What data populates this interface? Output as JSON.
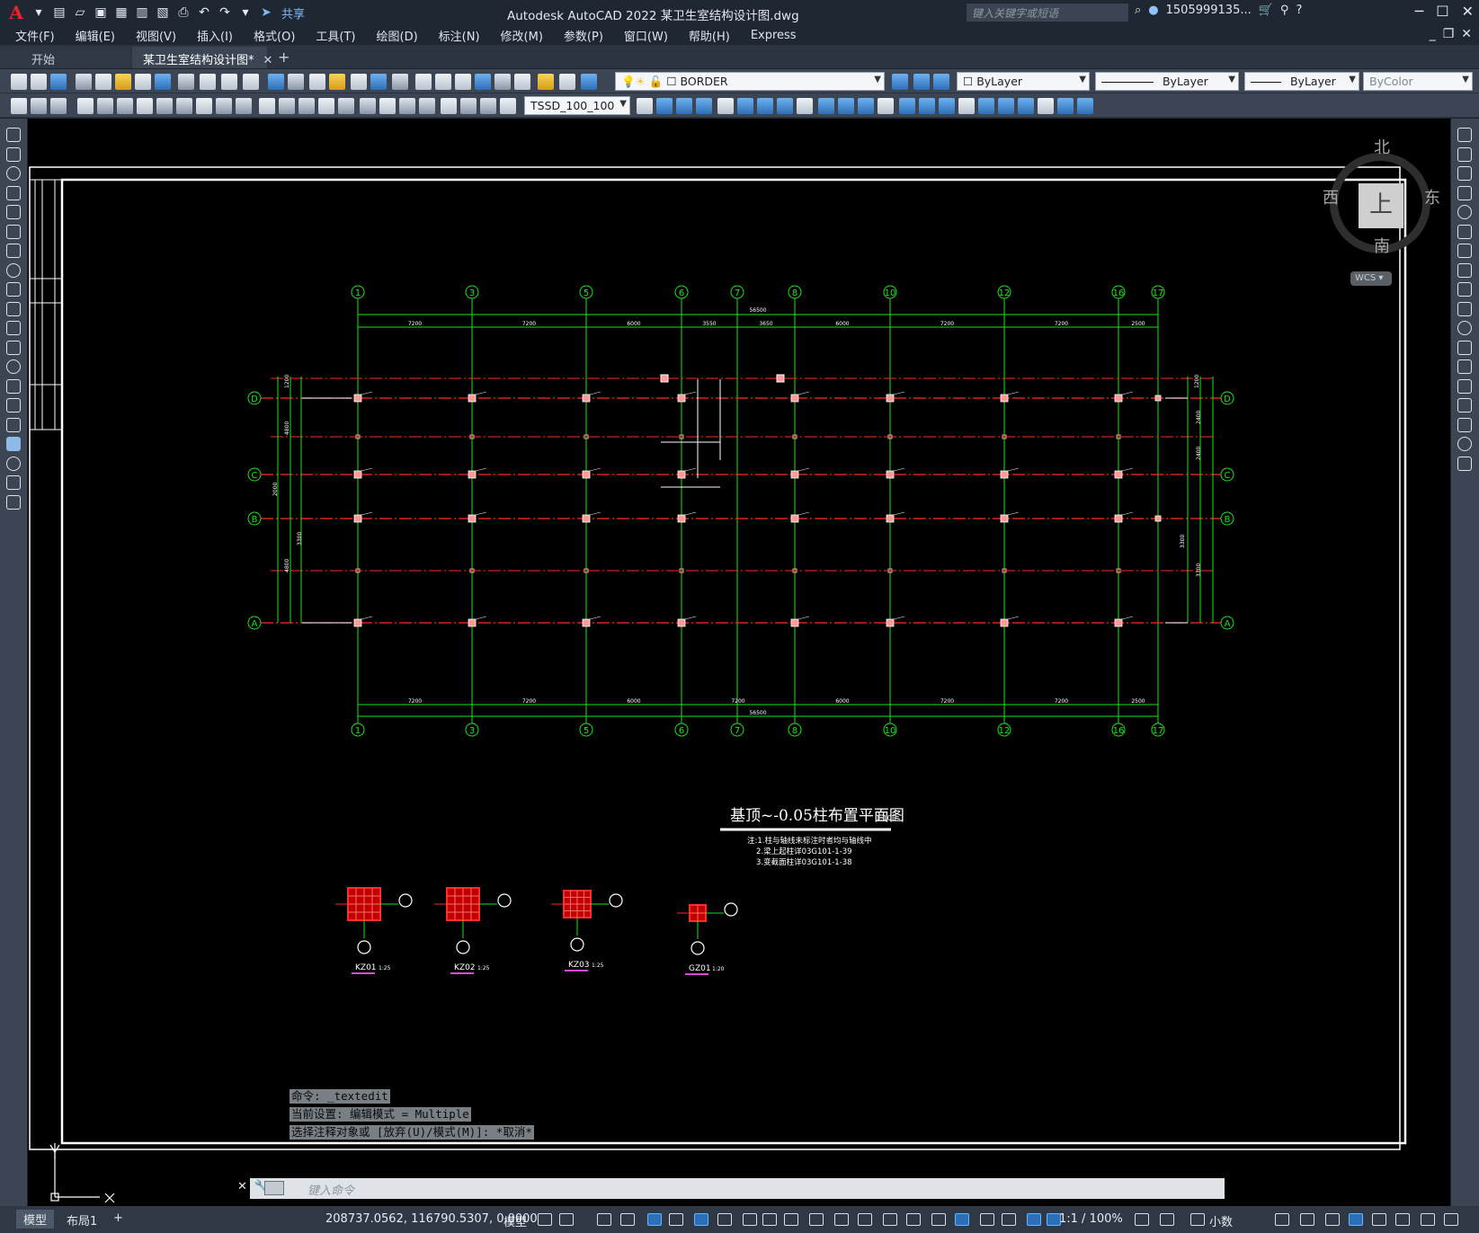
{
  "titlebar": {
    "share_label": "共享",
    "app_title": "Autodesk AutoCAD 2022    某卫生室结构设计图.dwg",
    "search_placeholder": "键入关键字或短语",
    "user": "1505999135...",
    "logo_letter": "A"
  },
  "menu": {
    "items": [
      "文件(F)",
      "编辑(E)",
      "视图(V)",
      "插入(I)",
      "格式(O)",
      "工具(T)",
      "绘图(D)",
      "标注(N)",
      "修改(M)",
      "参数(P)",
      "窗口(W)",
      "帮助(H)",
      "Express"
    ]
  },
  "tabs": {
    "start": "开始",
    "drawing": "某卫生室结构设计图*",
    "add": "+"
  },
  "toolbar": {
    "layer": "BORDER",
    "color": "ByLayer",
    "linetype": "ByLayer",
    "lineweight": "ByLayer",
    "plotstyle": "ByColor",
    "dimstyle": "TSSD_100_100"
  },
  "viewcube": {
    "north": "北",
    "south": "南",
    "east": "东",
    "west": "西",
    "top": "上",
    "wcs": "WCS"
  },
  "drawing": {
    "title": "基顶~-0.05柱布置平面图",
    "scale": "1:100",
    "notes": [
      "注:1.柱与轴线未标注时者均与轴线中",
      "2.梁上起柱详03G101-1-39",
      "3.变截面柱详03G101-1-38"
    ],
    "overall_dim": "56500",
    "top_dims": [
      "7200",
      "7200",
      "6000",
      "3550",
      "3650",
      "6000",
      "7200",
      "7200",
      "2500"
    ],
    "bottom_dims": [
      "7200",
      "7200",
      "6000",
      "7200",
      "6000",
      "7200",
      "7200",
      "2500"
    ],
    "column_labels": [
      "1",
      "3",
      "5",
      "6",
      "7",
      "8",
      "10",
      "12",
      "16",
      "17"
    ],
    "row_labels": [
      "D",
      "C",
      "B",
      "A"
    ],
    "left_dims": [
      "1200",
      "4800",
      "2000",
      "3300",
      "4800"
    ],
    "right_dims": [
      "1200",
      "2400",
      "2400",
      "3300",
      "3300"
    ],
    "details": [
      {
        "name": "KZ01",
        "scale": "1:25"
      },
      {
        "name": "KZ02",
        "scale": "1:25"
      },
      {
        "name": "KZ03",
        "scale": "1:25"
      },
      {
        "name": "GZ01",
        "scale": "1:20"
      }
    ]
  },
  "command": {
    "history": [
      "命令: _textedit",
      "当前设置: 编辑模式 = Multiple",
      "选择注释对象或 [放弃(U)/模式(M)]: *取消*"
    ],
    "placeholder": "键入命令"
  },
  "status": {
    "tab_model": "模型",
    "tab_layout": "布局1",
    "add": "+",
    "coords": "208737.0562, 116790.5307, 0.0000",
    "space": "模型",
    "scale": "1:1 / 100%",
    "units": "小数"
  }
}
